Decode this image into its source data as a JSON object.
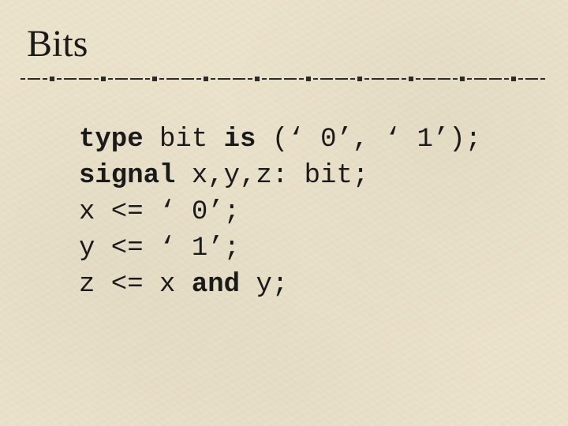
{
  "slide": {
    "title": "Bits"
  },
  "code": {
    "type_kw": "type",
    "type_rest": " bit ",
    "is_kw": "is",
    "type_tail": " (‘ 0’, ‘ 1’);",
    "signal_kw": "signal",
    "signal_rest": " x,y,z: bit;",
    "line3": "x <= ‘ 0’;",
    "line4": "y <= ‘ 1’;",
    "line5_pre": "z <= x ",
    "and_kw": "and",
    "line5_post": " y;"
  }
}
